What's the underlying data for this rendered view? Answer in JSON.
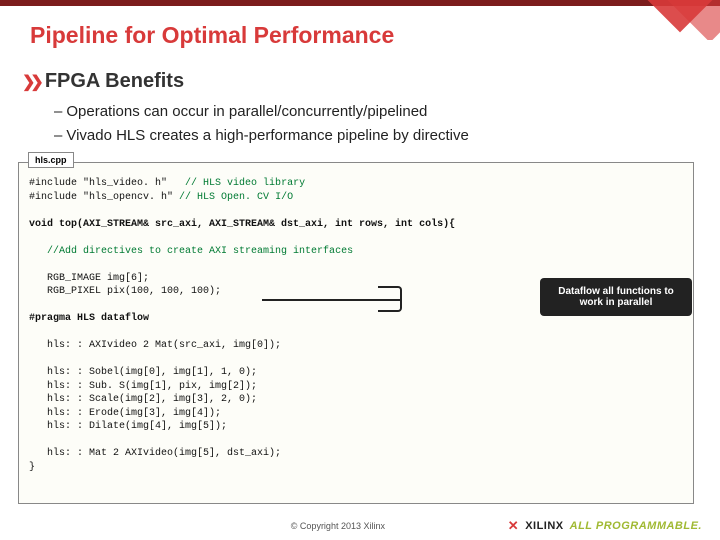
{
  "title": "Pipeline for Optimal Performance",
  "subtitle": "FPGA Benefits",
  "bullets": {
    "b1": "Operations can occur in parallel/concurrently/pipelined",
    "b2": "Vivado HLS creates a high-performance pipeline by directive"
  },
  "filename": "hls.cpp",
  "code": {
    "inc1": "#include \"hls_video. h\"",
    "inc1_c": "// HLS video library",
    "inc2": "#include \"hls_opencv. h\"",
    "inc2_c": "// HLS Open. CV I/O",
    "sig": "void top(AXI_STREAM& src_axi, AXI_STREAM& dst_axi, int rows, int cols){",
    "cmt_add": "//Add directives to create AXI streaming interfaces",
    "decl1": "RGB_IMAGE img[6];",
    "decl2": "RGB_PIXEL pix(100, 100, 100);",
    "pragma": "#pragma HLS dataflow",
    "l_axi2mat": "hls: : AXIvideo 2 Mat(src_axi, img[0]);",
    "l_sobel": "hls: : Sobel(img[0], img[1], 1, 0);",
    "l_subs": "hls: : Sub. S(img[1], pix, img[2]);",
    "l_scale": "hls: : Scale(img[2], img[3], 2, 0);",
    "l_erode": "hls: : Erode(img[3], img[4]);",
    "l_dilate": "hls: : Dilate(img[4], img[5]);",
    "l_mat2axi": "hls: : Mat 2 AXIvideo(img[5], dst_axi);",
    "close": "}"
  },
  "callout": "Dataflow all functions to work in parallel",
  "footer": {
    "copyright": "© Copyright 2013 Xilinx",
    "brand_name": "XILINX",
    "brand_tag": "ALL PROGRAMMABLE."
  }
}
